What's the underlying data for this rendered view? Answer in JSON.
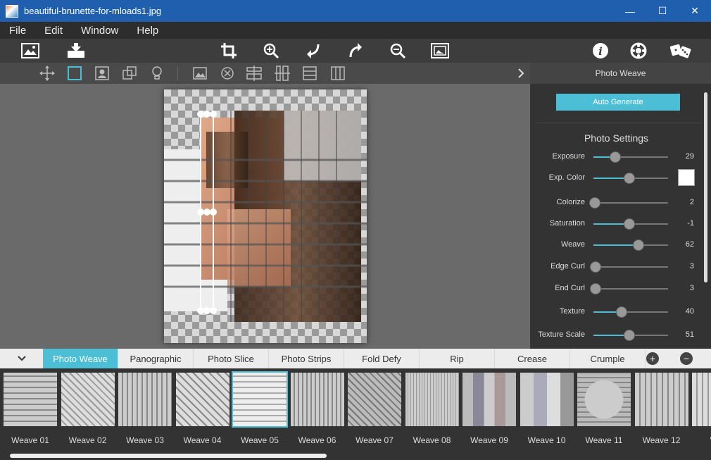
{
  "window": {
    "title": "beautiful-brunette-for-mloads1.jpg",
    "minimize": "—",
    "maximize": "☐",
    "close": "✕"
  },
  "menu": [
    "File",
    "Edit",
    "Window",
    "Help"
  ],
  "panel": {
    "header": "Photo Weave",
    "auto_generate": "Auto Generate",
    "settings_title": "Photo Settings",
    "sliders": [
      {
        "label": "Exposure",
        "value": "29",
        "level": 0.29
      },
      {
        "label": "Exp. Color",
        "value": "",
        "level": 0.48
      },
      {
        "label": "Colorize",
        "value": "2",
        "level": 0.02
      },
      {
        "label": "Saturation",
        "value": "-1",
        "level": 0.48
      },
      {
        "label": "Weave",
        "value": "62",
        "level": 0.6
      },
      {
        "label": "Edge Curl",
        "value": "3",
        "level": 0.03
      },
      {
        "label": "End Curl",
        "value": "3",
        "level": 0.03
      },
      {
        "label": "Texture",
        "value": "40",
        "level": 0.38
      },
      {
        "label": "Texture Scale",
        "value": "51",
        "level": 0.48
      }
    ],
    "accent_color": "#4cbfd6"
  },
  "tabs": [
    "Photo Weave",
    "Panographic",
    "Photo Slice",
    "Photo Strips",
    "Fold Defy",
    "Rip",
    "Crease",
    "Crumple"
  ],
  "active_tab": "Photo Weave",
  "thumbnails": [
    "Weave 01",
    "Weave 02",
    "Weave 03",
    "Weave 04",
    "Weave 05",
    "Weave 06",
    "Weave 07",
    "Weave 08",
    "Weave 09",
    "Weave 10",
    "Weave 11",
    "Weave 12",
    "Wea"
  ],
  "selected_thumbnail": "Weave 05",
  "icons": {
    "toolbar1": [
      "open-image-icon",
      "save-icon",
      "crop-icon",
      "zoom-in-icon",
      "undo-icon",
      "redo-icon",
      "zoom-out-icon",
      "fit-screen-icon",
      "info-icon",
      "settings-icon",
      "randomize-dice-icon"
    ],
    "toolbar2": [
      "move-icon",
      "select-icon",
      "subject-select-icon",
      "transform-icon",
      "lightbulb-icon",
      "image-layer-icon",
      "remove-icon",
      "horizontal-strips-icon",
      "vertical-strips-icon",
      "horizontal-weave-icon",
      "vertical-weave-icon"
    ]
  }
}
